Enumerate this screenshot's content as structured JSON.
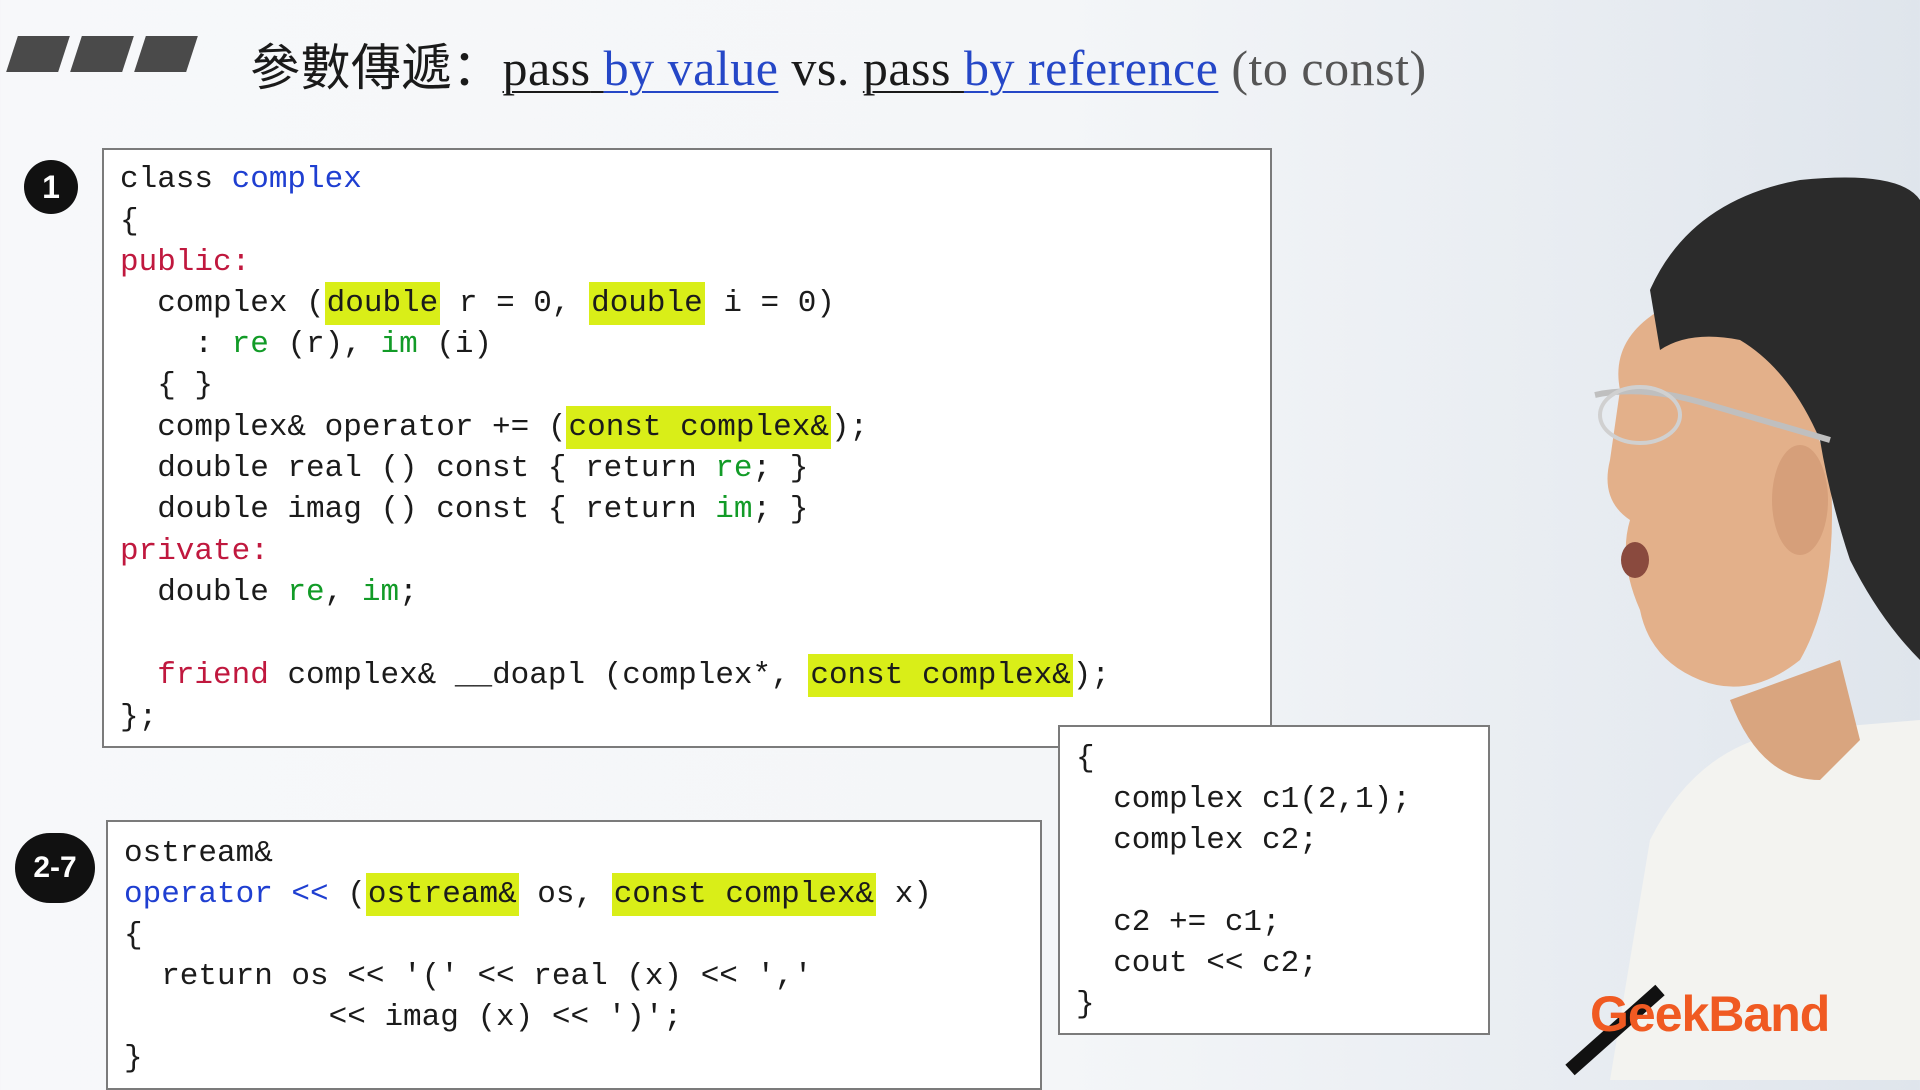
{
  "header": {
    "title_prefix": "參數傳遞：",
    "pass1": "pass",
    "by_value": "by value",
    "vs": "vs.",
    "pass2": "pass",
    "by_reference": "by reference",
    "to_const": "(to const)"
  },
  "badges": {
    "first": "1",
    "second": "2-7"
  },
  "panel1": {
    "l1_a": "class ",
    "l1_b": "complex",
    "l2": "{",
    "l3": "public:",
    "l4_a": "  complex (",
    "l4_b": "double",
    "l4_c": " r = 0, ",
    "l4_d": "double",
    "l4_e": " i = 0)",
    "l5_a": "    : ",
    "l5_b": "re",
    "l5_c": " (r), ",
    "l5_d": "im",
    "l5_e": " (i)",
    "l6": "  { }",
    "l7_a": "  complex& operator += (",
    "l7_b": "const complex&",
    "l7_c": ");",
    "l8_a": "  double real () const { return ",
    "l8_b": "re",
    "l8_c": "; }",
    "l9_a": "  double imag () const { return ",
    "l9_b": "im",
    "l9_c": "; }",
    "l10": "private:",
    "l11_a": "  double ",
    "l11_b": "re",
    "l11_c": ", ",
    "l11_d": "im",
    "l11_e": ";",
    "l12_a": "  ",
    "l12_b": "friend",
    "l12_c": " complex& __doapl (complex*, ",
    "l12_d": "const complex&",
    "l12_e": ");",
    "l13": "};"
  },
  "panel2": {
    "l1": "ostream&",
    "l2_a": "operator <<",
    "l2_b": " (",
    "l2_c": "ostream&",
    "l2_d": " os, ",
    "l2_e": "const complex&",
    "l2_f": " x)",
    "l3": "{",
    "l4": "  return os << '(' << real (x) << ','",
    "l5": "           << imag (x) << ')';",
    "l6": "}"
  },
  "panel3": {
    "l1": "{",
    "l2": "  complex c1(2,1);",
    "l3": "  complex c2;",
    "l4": "  c2 += c1;",
    "l5": "  cout << c2;",
    "l6": "}"
  },
  "logo": "GeekBand",
  "colors": {
    "highlight": "#d9ee18",
    "blue": "#1f3fd1",
    "green": "#129b27",
    "red": "#c0183e",
    "logo": "#f05a22"
  }
}
